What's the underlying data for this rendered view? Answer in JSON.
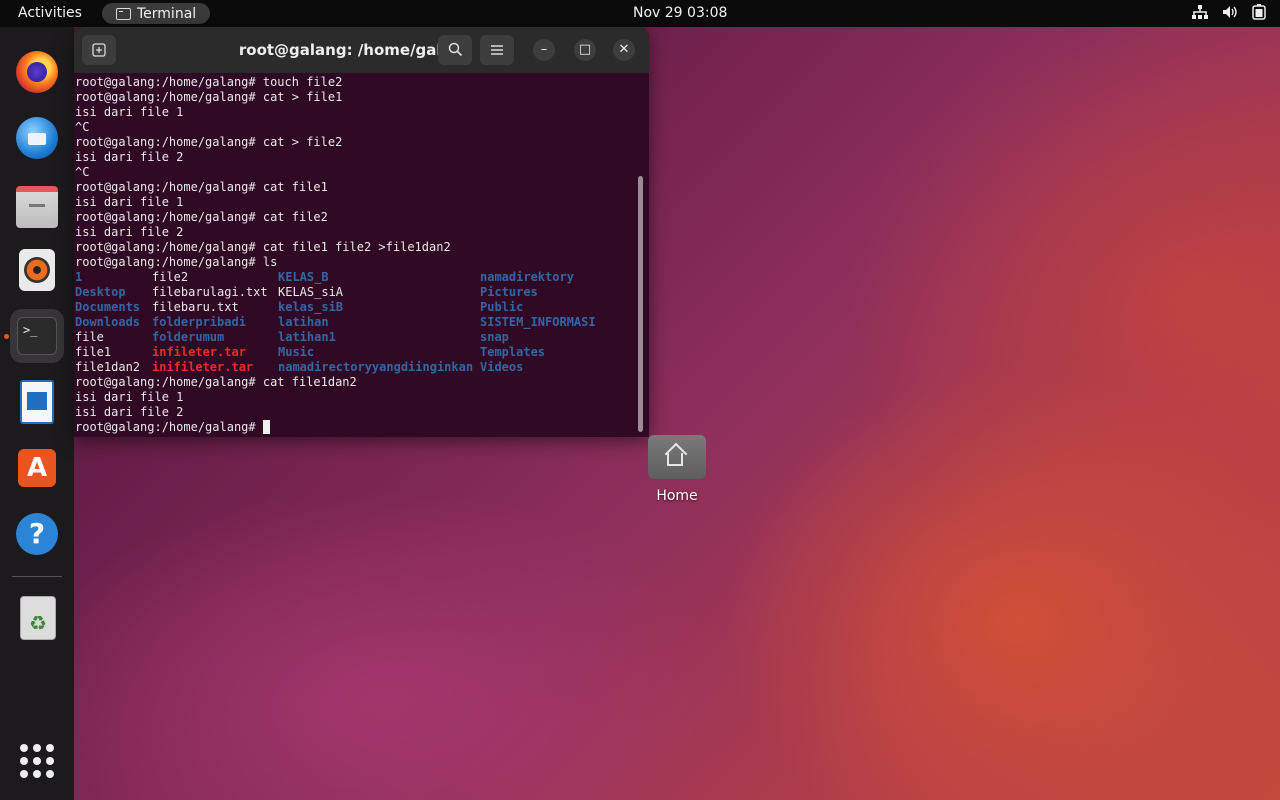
{
  "topbar": {
    "activities": "Activities",
    "app_name": "Terminal",
    "clock": "Nov 29  03:08",
    "tray_icons": [
      "network-icon",
      "volume-icon",
      "battery-icon"
    ]
  },
  "dock": {
    "items": [
      "firefox",
      "thunderbird",
      "files",
      "rhythmbox",
      "terminal",
      "libreoffice-writer",
      "ubuntu-software",
      "help",
      "trash",
      "show-applications"
    ],
    "active": "terminal",
    "accent": "#e95420"
  },
  "window": {
    "title": "root@galang: /home/galang",
    "background": "#300a24"
  },
  "terminal": {
    "lines_before_ls": [
      "root@galang:/home/galang# touch file2",
      "root@galang:/home/galang# cat > file1",
      "isi dari file 1",
      "^C",
      "root@galang:/home/galang# cat > file2",
      "isi dari file 2",
      "^C",
      "root@galang:/home/galang# cat file1",
      "isi dari file 1",
      "root@galang:/home/galang# cat file2",
      "isi dari file 2",
      "root@galang:/home/galang# cat file1 file2 >file1dan2",
      "root@galang:/home/galang# ls"
    ],
    "ls_rows": [
      [
        {
          "t": "1",
          "k": "dir"
        },
        {
          "t": "file2",
          "k": "reg"
        },
        {
          "t": "KELAS_B",
          "k": "dir"
        },
        {
          "t": "namadirektory",
          "k": "dir"
        }
      ],
      [
        {
          "t": "Desktop",
          "k": "dir"
        },
        {
          "t": "filebarulagi.txt",
          "k": "reg"
        },
        {
          "t": "KELAS_siA",
          "k": "reg"
        },
        {
          "t": "Pictures",
          "k": "dir"
        }
      ],
      [
        {
          "t": "Documents",
          "k": "dir"
        },
        {
          "t": "filebaru.txt",
          "k": "reg"
        },
        {
          "t": "kelas_siB",
          "k": "dir"
        },
        {
          "t": "Public",
          "k": "dir"
        }
      ],
      [
        {
          "t": "Downloads",
          "k": "dir"
        },
        {
          "t": "folderpribadi",
          "k": "dir"
        },
        {
          "t": "latihan",
          "k": "dir"
        },
        {
          "t": "SISTEM_INFORMASI",
          "k": "dir"
        }
      ],
      [
        {
          "t": "file",
          "k": "reg"
        },
        {
          "t": "folderumum",
          "k": "dir"
        },
        {
          "t": "latihan1",
          "k": "dir"
        },
        {
          "t": "snap",
          "k": "dir"
        }
      ],
      [
        {
          "t": "file1",
          "k": "reg"
        },
        {
          "t": "infileter.tar",
          "k": "arc"
        },
        {
          "t": "Music",
          "k": "dir"
        },
        {
          "t": "Templates",
          "k": "dir"
        }
      ],
      [
        {
          "t": "file1dan2",
          "k": "reg"
        },
        {
          "t": "inifileter.tar",
          "k": "arc"
        },
        {
          "t": "namadirectoryyangdiinginkan",
          "k": "dir"
        },
        {
          "t": "Videos",
          "k": "dir"
        }
      ]
    ],
    "lines_after_ls": [
      "root@galang:/home/galang# cat file1dan2",
      "isi dari file 1",
      "isi dari file 2"
    ],
    "prompt": "root@galang:/home/galang# ",
    "colors": {
      "dir": "#3465a4",
      "arc": "#ef2929",
      "text": "#e8e8e8"
    }
  },
  "desktop": {
    "home_label": "Home"
  }
}
